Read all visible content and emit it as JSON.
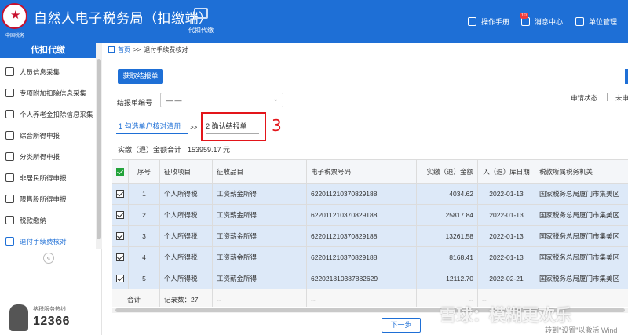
{
  "header": {
    "logo_text": "中国税务",
    "title": "自然人电子税务局（扣缴端）",
    "nav_tab": "代扣代缴",
    "links": [
      {
        "label": "操作手册",
        "icon": "manual-icon"
      },
      {
        "label": "消息中心",
        "icon": "message-icon",
        "badge": "10"
      },
      {
        "label": "单位管理",
        "icon": "unit-icon"
      }
    ],
    "color": "#1e6fd6"
  },
  "sidebar": {
    "title": "代扣代缴",
    "items": [
      {
        "label": "人员信息采集",
        "icon": "person-icon"
      },
      {
        "label": "专项附加扣除信息采集",
        "icon": "document-icon"
      },
      {
        "label": "个人养老金扣除信息采集",
        "icon": "list-icon"
      },
      {
        "label": "综合所得申报",
        "icon": "layers-icon"
      },
      {
        "label": "分类所得申报",
        "icon": "pie-icon"
      },
      {
        "label": "非居民所得申报",
        "icon": "user-icon"
      },
      {
        "label": "限售股所得申报",
        "icon": "chart-icon"
      },
      {
        "label": "税款缴纳",
        "icon": "tax-icon"
      },
      {
        "label": "退付手续费核对",
        "icon": "check-doc-icon",
        "active": true
      }
    ],
    "collapse": "«",
    "hotline_label": "纳税服务热线",
    "hotline_number": "12366"
  },
  "breadcrumb": {
    "home": "首页",
    "sep": ">>",
    "current": "退付手续费核对"
  },
  "toolbar": {
    "get_report": "获取结报单"
  },
  "filter": {
    "label": "结报单编号",
    "value": "— —",
    "status_label": "申请状态",
    "status_value": "未申"
  },
  "steps": {
    "step1": "1 勾选单户核对清册",
    "arrow": ">>",
    "step2": "2 确认结报单",
    "annotation": "3"
  },
  "summary": {
    "label": "实缴（退）金额合计",
    "amount": "153959.17 元"
  },
  "table": {
    "headers": [
      "序号",
      "征收项目",
      "征收品目",
      "电子税票号码",
      "实缴（退）金额",
      "入（退）库日期",
      "税款所属税务机关"
    ],
    "rows": [
      [
        "1",
        "个人所得税",
        "工资薪金所得",
        "622011210370829188",
        "4034.62",
        "2022-01-13",
        "国家税务总局厦门市集美区"
      ],
      [
        "2",
        "个人所得税",
        "工资薪金所得",
        "622011210370829188",
        "25817.84",
        "2022-01-13",
        "国家税务总局厦门市集美区"
      ],
      [
        "3",
        "个人所得税",
        "工资薪金所得",
        "622011210370829188",
        "13261.58",
        "2022-01-13",
        "国家税务总局厦门市集美区"
      ],
      [
        "4",
        "个人所得税",
        "工资薪金所得",
        "622011210370829188",
        "8168.41",
        "2022-01-13",
        "国家税务总局厦门市集美区"
      ],
      [
        "5",
        "个人所得税",
        "工资薪金所得",
        "622021810387882629",
        "12112.70",
        "2022-02-21",
        "国家税务总局厦门市集美区"
      ]
    ],
    "footer": {
      "label": "合计",
      "count": "记录数：27",
      "dash": "--"
    }
  },
  "next_button": "下一步",
  "watermark": {
    "main": "雪球：模糊更欢乐",
    "sub": "转到\"设置\"以激活 Wind"
  }
}
